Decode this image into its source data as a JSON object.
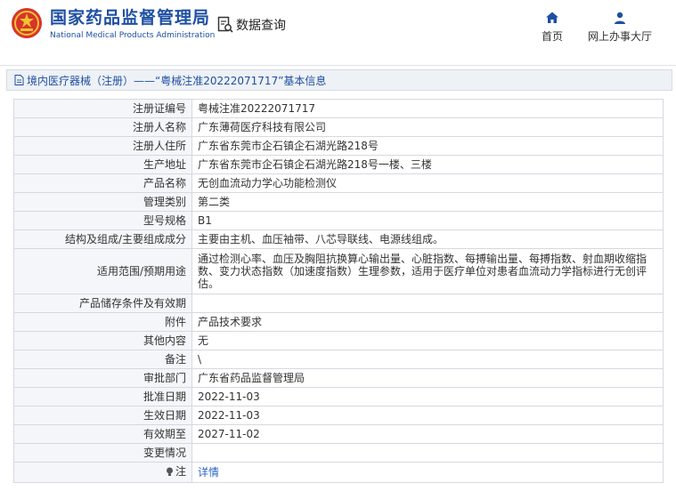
{
  "header": {
    "brand_cn": "国家药品监督管理局",
    "brand_en": "National Medical Products Administration",
    "query_label": "数据查询",
    "nav": {
      "home": "首页",
      "office": "网上办事大厅"
    }
  },
  "title": "境内医疗器械（注册）——“粤械注准20222071717”基本信息",
  "rows": [
    {
      "label": "注册证编号",
      "value": "粤械注准20222071717"
    },
    {
      "label": "注册人名称",
      "value": "广东薄荷医疗科技有限公司"
    },
    {
      "label": "注册人住所",
      "value": "广东省东莞市企石镇企石湖光路218号"
    },
    {
      "label": "生产地址",
      "value": "广东省东莞市企石镇企石湖光路218号一楼、三楼"
    },
    {
      "label": "产品名称",
      "value": "无创血流动力学心功能检测仪"
    },
    {
      "label": "管理类别",
      "value": "第二类"
    },
    {
      "label": "型号规格",
      "value": "B1"
    },
    {
      "label": "结构及组成/主要组成成分",
      "value": "主要由主机、血压袖带、八芯导联线、电源线组成。"
    },
    {
      "label": "适用范围/预期用途",
      "value": "通过检测心率、血压及胸阻抗换算心输出量、心脏指数、每搏输出量、每搏指数、射血期收缩指数、变力状态指数（加速度指数）生理参数，适用于医疗单位对患者血流动力学指标进行无创评估。"
    },
    {
      "label": "产品储存条件及有效期",
      "value": ""
    },
    {
      "label": "附件",
      "value": "产品技术要求"
    },
    {
      "label": "其他内容",
      "value": "无"
    },
    {
      "label": "备注",
      "value": "\\"
    },
    {
      "label": "审批部门",
      "value": "广东省药品监督管理局"
    },
    {
      "label": "批准日期",
      "value": "2022-11-03"
    },
    {
      "label": "生效日期",
      "value": "2022-11-03"
    },
    {
      "label": "有效期至",
      "value": "2027-11-02"
    },
    {
      "label": "变更情况",
      "value": ""
    }
  ],
  "note": {
    "label": "注",
    "link": "详情"
  },
  "colors": {
    "brand_blue": "#1e4fa3",
    "link": "#2a63c9",
    "label_bg": "#f4f6f9",
    "border": "#d5d9e0"
  }
}
